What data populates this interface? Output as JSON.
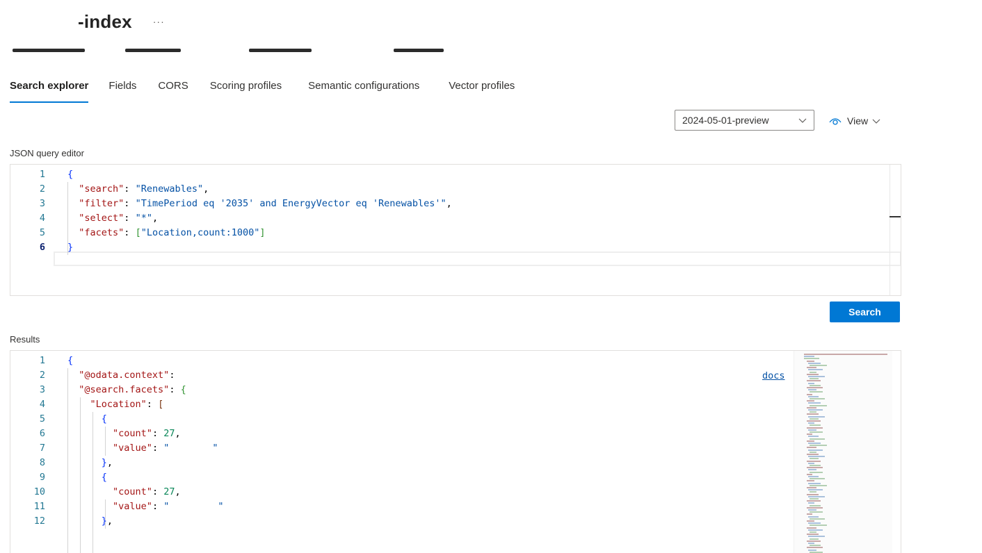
{
  "header": {
    "title": "-index",
    "more_label": "···"
  },
  "tabs": [
    {
      "label": "Search explorer",
      "active": true
    },
    {
      "label": "Fields",
      "active": false
    },
    {
      "label": "CORS",
      "active": false
    },
    {
      "label": "Scoring profiles",
      "active": false
    },
    {
      "label": "Semantic configurations",
      "active": false
    },
    {
      "label": "Vector profiles",
      "active": false
    }
  ],
  "toolbar": {
    "api_version": "2024-05-01-preview",
    "view_label": "View"
  },
  "editor": {
    "label": "JSON query editor",
    "current_line": 6,
    "lines": [
      {
        "n": "1"
      },
      {
        "n": "2",
        "key": "\"search\"",
        "sep": ": ",
        "value": "\"Renewables\"",
        "tail": ","
      },
      {
        "n": "3",
        "key": "\"filter\"",
        "sep": ": ",
        "value": "\"TimePeriod eq '2035' and EnergyVector eq 'Renewables'\"",
        "tail": ","
      },
      {
        "n": "4",
        "key": "\"select\"",
        "sep": ": ",
        "value": "\"*\"",
        "tail": ","
      },
      {
        "n": "5",
        "key": "\"facets\"",
        "sep": ": ",
        "value": "\"Location,count:1000\"",
        "tail": ""
      },
      {
        "n": "6"
      }
    ],
    "brace_open": "{",
    "brace_close": "}",
    "bracket_open": "[",
    "bracket_close": "]"
  },
  "search_button_label": "Search",
  "results": {
    "label": "Results",
    "docs_link": "docs",
    "line_numbers": [
      "1",
      "2",
      "3",
      "4",
      "5",
      "6",
      "7",
      "8",
      "9",
      "10",
      "11",
      "12"
    ],
    "odata_key": "\"@odata.context\"",
    "facets_key": "\"@search.facets\"",
    "location_key": "\"Location\"",
    "count_key": "\"count\"",
    "value_key": "\"value\"",
    "count_1": "27",
    "count_2": "27",
    "value_1_visible": "\"",
    "value_1_tail": "\"",
    "value_2_visible": "\"",
    "value_2_tail": "\""
  },
  "colors": {
    "accent": "#0078d4",
    "line_number": "#237893",
    "json_key": "#a31515",
    "json_string": "#0451a5",
    "json_number": "#098658"
  }
}
